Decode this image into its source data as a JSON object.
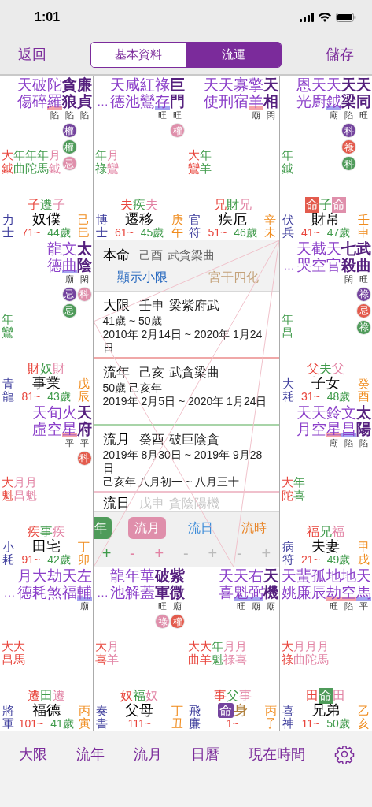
{
  "status_bar": {
    "time": "1:01"
  },
  "nav": {
    "back": "返回",
    "save": "儲存",
    "segments": [
      {
        "label": "基本資料",
        "selected": false
      },
      {
        "label": "流運",
        "selected": true
      }
    ]
  },
  "cells": [
    {
      "stars": [
        {
          "name": "天傷",
          "major": false
        },
        {
          "name": "破碎",
          "major": false
        },
        {
          "name": "陀羅",
          "major": false,
          "brightness": "陷",
          "color": "#f5a3a8"
        },
        {
          "name": "貪狼",
          "major": true,
          "brightness": "陷",
          "transforms": [
            {
              "text": "權",
              "kind": "natal"
            },
            {
              "text": "權",
              "kind": "year"
            },
            {
              "text": "忌",
              "kind": "month"
            }
          ]
        },
        {
          "name": "廉貞",
          "major": true,
          "brightness": "陷"
        }
      ],
      "flow_stars": [
        {
          "text": "大鉞",
          "kind": "decade"
        },
        {
          "text": "年曲",
          "kind": "year"
        },
        {
          "text": "年陀",
          "kind": "year"
        },
        {
          "text": "年馬",
          "kind": "year"
        },
        {
          "text": "月鉞",
          "kind": "month"
        }
      ],
      "flow_palaces": [
        {
          "text": "子",
          "kind": "decade",
          "boxed": false
        },
        {
          "text": "遷",
          "kind": "year",
          "boxed": false
        },
        {
          "text": "子",
          "kind": "month",
          "boxed": false
        }
      ],
      "name": "奴僕",
      "badge": false,
      "spirit": "力士",
      "start_age": "71~",
      "age": "44歲",
      "stem_branch": "己巳"
    },
    {
      "ellipsis": "…",
      "stars": [
        {
          "name": "天德",
          "major": false
        },
        {
          "name": "咸池",
          "major": false
        },
        {
          "name": "紅鸞",
          "major": false
        },
        {
          "name": "祿存",
          "major": false,
          "brightness": "旺",
          "color": "#a3a3f0"
        },
        {
          "name": "巨門",
          "major": true,
          "brightness": "旺",
          "transforms": [
            {
              "text": "權",
              "kind": "month"
            }
          ]
        }
      ],
      "flow_stars": [
        {
          "text": "年祿",
          "kind": "year"
        },
        {
          "text": "月鸞",
          "kind": "month"
        }
      ],
      "flow_palaces": [
        {
          "text": "夫",
          "kind": "decade",
          "boxed": false
        },
        {
          "text": "疾",
          "kind": "year",
          "boxed": false
        },
        {
          "text": "夫",
          "kind": "month",
          "boxed": false
        }
      ],
      "name": "遷移",
      "badge": false,
      "spirit": "博士",
      "start_age": "61~",
      "age": "45歲",
      "stem_branch": "庚午"
    },
    {
      "stars": [
        {
          "name": "天使",
          "major": false
        },
        {
          "name": "天刑",
          "major": false
        },
        {
          "name": "寡宿",
          "major": false
        },
        {
          "name": "擎羊",
          "major": false,
          "brightness": "廟",
          "color": "#f5a3a8"
        },
        {
          "name": "天相",
          "major": true,
          "brightness": "閑"
        }
      ],
      "flow_stars": [
        {
          "text": "大鸞",
          "kind": "decade"
        },
        {
          "text": "年羊",
          "kind": "year"
        }
      ],
      "flow_palaces": [
        {
          "text": "兄",
          "kind": "decade",
          "boxed": false
        },
        {
          "text": "財",
          "kind": "year",
          "boxed": false
        },
        {
          "text": "兄",
          "kind": "month",
          "boxed": false
        }
      ],
      "name": "疾厄",
      "badge": false,
      "spirit": "官符",
      "start_age": "51~",
      "age": "46歲",
      "stem_branch": "辛未"
    },
    {
      "stars": [
        {
          "name": "恩光",
          "major": false
        },
        {
          "name": "天廚",
          "major": false
        },
        {
          "name": "天鉞",
          "major": false,
          "brightness": "廟",
          "color": "#a3a3f0"
        },
        {
          "name": "天梁",
          "major": true,
          "brightness": "陷",
          "transforms": [
            {
              "text": "科",
              "kind": "natal"
            },
            {
              "text": "祿",
              "kind": "decade"
            },
            {
              "text": "科",
              "kind": "year"
            }
          ]
        },
        {
          "name": "天同",
          "major": true,
          "brightness": "旺"
        }
      ],
      "flow_stars": [
        {
          "text": "年鉞",
          "kind": "year"
        }
      ],
      "flow_palaces": [
        {
          "text": "命",
          "kind": "decade",
          "boxed": true
        },
        {
          "text": "子",
          "kind": "year",
          "boxed": false
        },
        {
          "text": "命",
          "kind": "month",
          "boxed": true
        }
      ],
      "name": "財帛",
      "badge": false,
      "spirit": "伏兵",
      "start_age": "41~",
      "age": "47歲",
      "stem_branch": "壬申"
    },
    {
      "stars": [
        {
          "name": "龍德",
          "major": false
        },
        {
          "name": "文曲",
          "major": false,
          "brightness": "廟",
          "color": "#a3a3f0",
          "transforms": [
            {
              "text": "忌",
              "kind": "natal"
            },
            {
              "text": "忌",
              "kind": "year"
            }
          ]
        },
        {
          "name": "太陰",
          "major": true,
          "brightness": "閑",
          "transforms": [
            {
              "text": "科",
              "kind": "month"
            }
          ]
        }
      ],
      "flow_stars": [
        {
          "text": "年鸞",
          "kind": "year"
        }
      ],
      "flow_palaces": [
        {
          "text": "財",
          "kind": "decade",
          "boxed": false
        },
        {
          "text": "奴",
          "kind": "year",
          "boxed": false
        },
        {
          "text": "財",
          "kind": "month",
          "boxed": false
        }
      ],
      "name": "事業",
      "badge": false,
      "spirit": "青龍",
      "start_age": "81~",
      "age": "43歲",
      "stem_branch": "戊辰"
    },
    {
      "ellipsis": "…",
      "stars": [
        {
          "name": "天哭",
          "major": false
        },
        {
          "name": "截空",
          "major": false
        },
        {
          "name": "天官",
          "major": false
        },
        {
          "name": "七殺",
          "major": true,
          "brightness": "閑"
        },
        {
          "name": "武曲",
          "major": true,
          "brightness": "旺",
          "transforms": [
            {
              "text": "祿",
              "kind": "natal"
            },
            {
              "text": "忌",
              "kind": "decade"
            },
            {
              "text": "祿",
              "kind": "year"
            }
          ]
        }
      ],
      "flow_stars": [
        {
          "text": "年昌",
          "kind": "year"
        }
      ],
      "flow_palaces": [
        {
          "text": "父",
          "kind": "decade",
          "boxed": false
        },
        {
          "text": "夫",
          "kind": "year",
          "boxed": false
        },
        {
          "text": "父",
          "kind": "month",
          "boxed": false
        }
      ],
      "name": "子女",
      "badge": false,
      "spirit": "大耗",
      "start_age": "31~",
      "age": "48歲",
      "stem_branch": "癸酉"
    },
    {
      "stars": [
        {
          "name": "天虛",
          "major": false
        },
        {
          "name": "旬空",
          "major": false
        },
        {
          "name": "火星",
          "major": false,
          "brightness": "平",
          "color": "#f5a3a8"
        },
        {
          "name": "天府",
          "major": true,
          "brightness": "平",
          "transforms": [
            {
              "text": "科",
              "kind": "decade"
            }
          ]
        }
      ],
      "flow_stars": [
        {
          "text": "大魁",
          "kind": "decade"
        },
        {
          "text": "月昌",
          "kind": "month"
        },
        {
          "text": "月魁",
          "kind": "month"
        }
      ],
      "flow_palaces": [
        {
          "text": "疾",
          "kind": "decade",
          "boxed": false
        },
        {
          "text": "事",
          "kind": "year",
          "boxed": false
        },
        {
          "text": "疾",
          "kind": "month",
          "boxed": false
        }
      ],
      "name": "田宅",
      "badge": false,
      "spirit": "小耗",
      "start_age": "91~",
      "age": "42歲",
      "stem_branch": "丁卯"
    },
    {
      "stars": [
        {
          "name": "天月",
          "major": false
        },
        {
          "name": "天空",
          "major": false
        },
        {
          "name": "鈴星",
          "major": false,
          "brightness": "廟",
          "color": "#f5a3a8"
        },
        {
          "name": "文昌",
          "major": false,
          "brightness": "陷",
          "color": "#a3a3f0"
        },
        {
          "name": "太陽",
          "major": true,
          "brightness": "陷"
        }
      ],
      "flow_stars": [
        {
          "text": "大陀",
          "kind": "decade"
        },
        {
          "text": "年喜",
          "kind": "year"
        }
      ],
      "flow_palaces": [
        {
          "text": "福",
          "kind": "decade",
          "boxed": false
        },
        {
          "text": "兄",
          "kind": "year",
          "boxed": false
        },
        {
          "text": "福",
          "kind": "month",
          "boxed": false
        }
      ],
      "name": "夫妻",
      "badge": false,
      "spirit": "病符",
      "start_age": "21~",
      "age": "49歲",
      "stem_branch": "甲戌"
    },
    {
      "ellipsis": "…",
      "stars": [
        {
          "name": "月德",
          "major": false
        },
        {
          "name": "大耗",
          "major": false
        },
        {
          "name": "劫煞",
          "major": false
        },
        {
          "name": "天福",
          "major": false
        },
        {
          "name": "左輔",
          "major": false,
          "brightness": "廟",
          "color": "#a3a3f0"
        }
      ],
      "flow_stars": [
        {
          "text": "大昌",
          "kind": "decade"
        },
        {
          "text": "大馬",
          "kind": "decade"
        }
      ],
      "flow_palaces": [
        {
          "text": "遷",
          "kind": "decade",
          "boxed": false
        },
        {
          "text": "田",
          "kind": "year",
          "boxed": false
        },
        {
          "text": "遷",
          "kind": "month",
          "boxed": false
        }
      ],
      "name": "福德",
      "badge": false,
      "spirit": "將軍",
      "start_age": "101~",
      "age": "41歲",
      "stem_branch": "丙寅"
    },
    {
      "ellipsis": "…",
      "stars": [
        {
          "name": "龍池",
          "major": false
        },
        {
          "name": "年解",
          "major": false
        },
        {
          "name": "華蓋",
          "major": false
        },
        {
          "name": "破軍",
          "major": true,
          "brightness": "旺",
          "transforms": [
            {
              "text": "祿",
              "kind": "month"
            }
          ]
        },
        {
          "name": "紫微",
          "major": true,
          "brightness": "廟",
          "transforms": [
            {
              "text": "權",
              "kind": "decade"
            }
          ]
        }
      ],
      "flow_stars": [
        {
          "text": "大喜",
          "kind": "decade"
        },
        {
          "text": "月羊",
          "kind": "month"
        }
      ],
      "flow_palaces": [
        {
          "text": "奴",
          "kind": "decade",
          "boxed": false
        },
        {
          "text": "福",
          "kind": "year",
          "boxed": false
        },
        {
          "text": "奴",
          "kind": "month",
          "boxed": false
        }
      ],
      "name": "父母",
      "badge": false,
      "spirit": "奏書",
      "start_age": "111~",
      "stem_branch": "丁丑"
    },
    {
      "stars": [
        {
          "name": "天喜",
          "major": false
        },
        {
          "name": "天魁",
          "major": false,
          "brightness": "旺",
          "color": "#a3a3f0"
        },
        {
          "name": "右弼",
          "major": false,
          "brightness": "廟",
          "color": "#a3a3f0"
        },
        {
          "name": "天機",
          "major": true,
          "brightness": "廟"
        }
      ],
      "flow_stars": [
        {
          "text": "大曲",
          "kind": "decade"
        },
        {
          "text": "大羊",
          "kind": "decade"
        },
        {
          "text": "年魁",
          "kind": "year"
        },
        {
          "text": "月祿",
          "kind": "month"
        },
        {
          "text": "月喜",
          "kind": "month"
        }
      ],
      "flow_palaces": [
        {
          "text": "事",
          "kind": "decade",
          "boxed": false
        },
        {
          "text": "父",
          "kind": "year",
          "boxed": false
        },
        {
          "text": "事",
          "kind": "month",
          "boxed": false
        }
      ],
      "name": "命",
      "badge": true,
      "body": "身",
      "spirit": "飛廉",
      "start_age": "1~",
      "stem_branch": "丙子"
    },
    {
      "stars": [
        {
          "name": "天姚",
          "major": false
        },
        {
          "name": "蜚廉",
          "major": false
        },
        {
          "name": "孤辰",
          "major": false
        },
        {
          "name": "地劫",
          "major": false,
          "brightness": "旺",
          "color": "#f5a3a8"
        },
        {
          "name": "地空",
          "major": false,
          "brightness": "陷",
          "color": "#f5a3a8"
        },
        {
          "name": "天馬",
          "major": false,
          "brightness": "平",
          "color": "#a3a3f0"
        }
      ],
      "flow_stars": [
        {
          "text": "大祿",
          "kind": "decade"
        },
        {
          "text": "月曲",
          "kind": "month"
        },
        {
          "text": "月陀",
          "kind": "month"
        },
        {
          "text": "月馬",
          "kind": "month"
        }
      ],
      "flow_palaces": [
        {
          "text": "田",
          "kind": "decade",
          "boxed": false
        },
        {
          "text": "命",
          "kind": "year",
          "boxed": true
        },
        {
          "text": "田",
          "kind": "month",
          "boxed": false
        }
      ],
      "name": "兄弟",
      "badge": false,
      "spirit": "喜神",
      "start_age": "11~",
      "age": "50歲",
      "stem_branch": "乙亥"
    }
  ],
  "center": {
    "natal": {
      "label": "本命",
      "ganzhi": "己酉",
      "stars": "武貪梁曲"
    },
    "minor_limit_link": "顯示小限",
    "palace_stem_link": "宮干四化",
    "periods": [
      {
        "kind": "decade",
        "label": "大限",
        "ganzhi": "壬申",
        "stars": "梁紫府武",
        "disabled": false,
        "lines": [
          "41歲 ~ 50歲",
          "2010年 2月14日 ~ 2020年 1月24日"
        ]
      },
      {
        "kind": "year",
        "label": "流年",
        "ganzhi": "己亥",
        "stars": "武貪梁曲",
        "disabled": false,
        "lines": [
          "50歲 己亥年",
          "2019年 2月5日 ~ 2020年 1月24日"
        ]
      },
      {
        "kind": "month",
        "label": "流月",
        "ganzhi": "癸酉",
        "stars": "破巨陰貪",
        "disabled": false,
        "lines": [
          "2019年 8月30日 ~ 2019年 9月28日",
          "己亥年 八月初一 ~ 八月三十"
        ]
      },
      {
        "kind": "day",
        "label": "流日",
        "ganzhi": "戊申",
        "stars": "貪陰陽機",
        "disabled": true
      }
    ],
    "tabs": [
      {
        "label": "年",
        "kind": "year",
        "selected": true,
        "cut": true,
        "stepper": [
          "+"
        ]
      },
      {
        "label": "流月",
        "kind": "month",
        "selected": true,
        "cut": false,
        "stepper": [
          "-",
          "+"
        ]
      },
      {
        "label": "流日",
        "kind": "day",
        "selected": false,
        "cut": false,
        "stepper": [
          "-",
          "+"
        ]
      },
      {
        "label": "流時",
        "kind": "hour",
        "selected": false,
        "cut": false,
        "stepper": [
          "-",
          "+"
        ]
      }
    ]
  },
  "bottom_tabs": [
    "大限",
    "流年",
    "流月",
    "日曆",
    "現在時間"
  ]
}
